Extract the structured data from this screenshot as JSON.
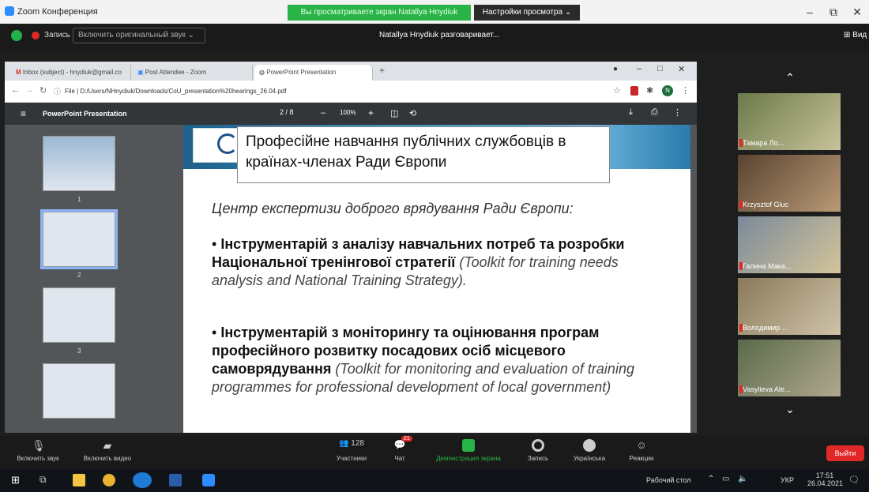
{
  "window": {
    "title": "Zoom Конференция"
  },
  "share_banner": "Вы просматриваете экран Natallya Hnydiuk",
  "view_options": "Настройки просмотра",
  "zoom_top": {
    "rec_label": "Запись",
    "orig_sound": "Включить оригинальный звук",
    "speaking": "Natallya Hnydiuk разговаривает...",
    "view_btn": "Вид"
  },
  "browser": {
    "tabs": [
      {
        "label": "Inbox (subject) - hnydiuk@gmail.co"
      },
      {
        "label": "Post Attendee - Zoom"
      },
      {
        "label": "PowerPoint Presentation"
      }
    ],
    "url": "File | D:/Users/NHnydiuk/Downloads/CoU_presentation%20hearings_26.04.pdf",
    "avatar_letter": "N"
  },
  "pdf": {
    "title": "PowerPoint Presentation",
    "page": "2 / 8",
    "zoom": "100%",
    "thumb_numbers": [
      "1",
      "2",
      "3"
    ]
  },
  "slide": {
    "title": "Професійне навчання публічних службовців в країнах-членах Ради Європи",
    "subtitle": "Центр експертизи доброго врядування Ради Європи:",
    "bullet1_bold": "Інструментарій з аналізу навчальних потреб та розробки Національної тренінгової стратегії",
    "bullet1_italic": "(Toolkit for training needs analysis and National Training Strategy).",
    "bullet2_bold": "Інструментарій з моніторингу та оцінювання програм професійного розвитку посадових осіб місцевого самоврядування",
    "bullet2_italic": "(Toolkit for monitoring and evaluation of training programmes for professional development of local government)"
  },
  "participants": [
    {
      "name": "Тамара Ло..."
    },
    {
      "name": "Krzysztof Gluc"
    },
    {
      "name": "Галина Мака..."
    },
    {
      "name": "Володимир ..."
    },
    {
      "name": "Vasylieva Ale..."
    }
  ],
  "toolbar": {
    "mute": "Включить звук",
    "video": "Включить видео",
    "participants": "Участники",
    "participants_count": "128",
    "chat": "Чат",
    "chat_badge": "21",
    "share": "Демонстрация экрана",
    "record": "Запись",
    "lang": "Українська",
    "reactions": "Реакции",
    "exit": "Выйти"
  },
  "taskbar": {
    "desktop": "Рабочий стол",
    "lang": "УКР",
    "time": "17:51",
    "date": "26.04.2021"
  },
  "colors": {
    "zoom_green": "#28b446",
    "exit_red": "#e02828",
    "chrome_blue": "#1a73e8"
  }
}
